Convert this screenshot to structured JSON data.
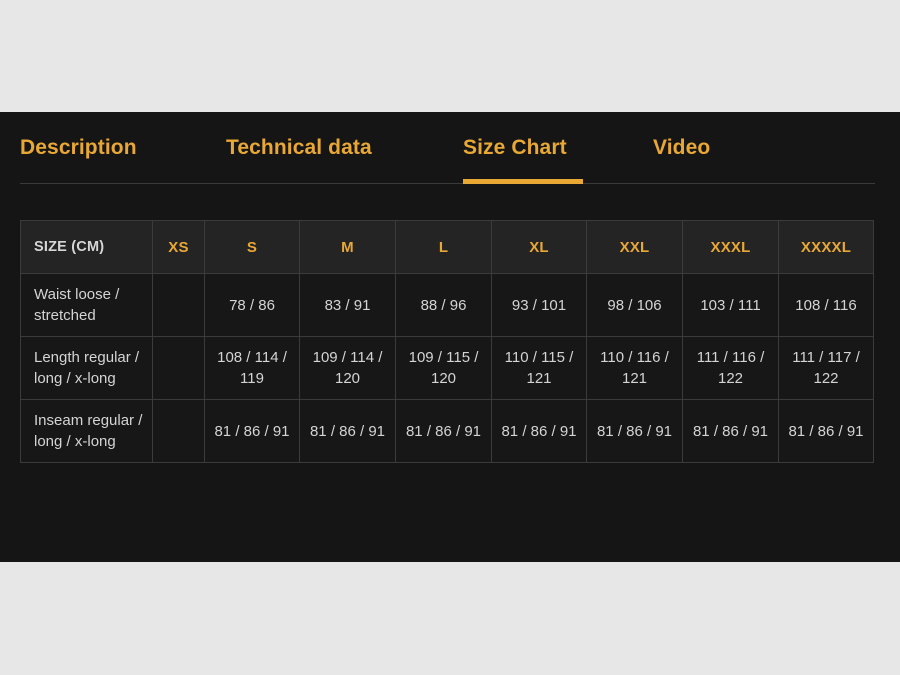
{
  "page": {
    "background_color": "#e7e7e7",
    "panel_color": "#151515",
    "accent_color": "#e9a834"
  },
  "tabs": [
    {
      "label": "Description",
      "active": false
    },
    {
      "label": "Technical data",
      "active": false
    },
    {
      "label": "Size Chart",
      "active": true
    },
    {
      "label": "Video",
      "active": false
    }
  ],
  "size_chart": {
    "columns": [
      "SIZE (CM)",
      "XS",
      "S",
      "M",
      "L",
      "XL",
      "XXL",
      "XXXL",
      "XXXXL"
    ],
    "rows": [
      {
        "label": "Waist loose / stretched",
        "values": [
          "",
          "78 / 86",
          "83 / 91",
          "88 / 96",
          "93 / 101",
          "98 / 106",
          "103 / 111",
          "108 / 116"
        ]
      },
      {
        "label": "Length regular / long / x-long",
        "values": [
          "",
          "108 / 114 / 119",
          "109 / 114 / 120",
          "109 / 115 / 120",
          "110 / 115 / 121",
          "110 / 116 / 121",
          "111 / 116 / 122",
          "111 / 117 / 122"
        ]
      },
      {
        "label": "Inseam regular / long / x-long",
        "values": [
          "",
          "81 / 86 / 91",
          "81 / 86 / 91",
          "81 / 86 / 91",
          "81 / 86 / 91",
          "81 / 86 / 91",
          "81 / 86 / 91",
          "81 / 86 / 91"
        ]
      }
    ]
  }
}
